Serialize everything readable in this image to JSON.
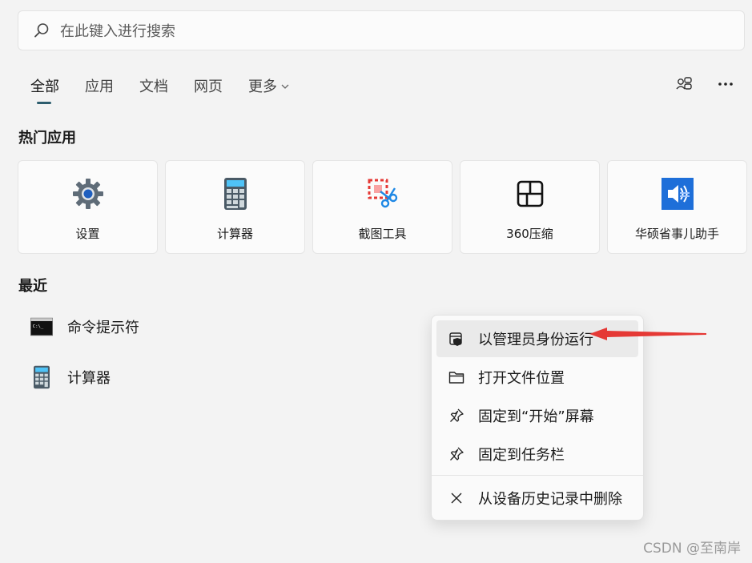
{
  "search": {
    "placeholder": "在此键入进行搜索"
  },
  "tabs": [
    {
      "label": "全部",
      "active": true
    },
    {
      "label": "应用"
    },
    {
      "label": "文档"
    },
    {
      "label": "网页"
    },
    {
      "label": "更多"
    }
  ],
  "sections": {
    "top_apps": "热门应用",
    "recent": "最近"
  },
  "top_apps": [
    {
      "label": "设置",
      "icon": "gear-icon"
    },
    {
      "label": "计算器",
      "icon": "calculator-icon"
    },
    {
      "label": "截图工具",
      "icon": "snipping-tool-icon"
    },
    {
      "label": "360压缩",
      "icon": "360-zip-icon"
    },
    {
      "label": "华硕省事儿助手",
      "icon": "asus-assistant-icon"
    }
  ],
  "recent": [
    {
      "label": "命令提示符",
      "icon": "terminal-icon"
    },
    {
      "label": "计算器",
      "icon": "calculator-icon"
    }
  ],
  "context_menu": [
    {
      "label": "以管理员身份运行",
      "icon": "shield-admin-icon",
      "highlighted": true
    },
    {
      "label": "打开文件位置",
      "icon": "folder-icon"
    },
    {
      "label": "固定到“开始”屏幕",
      "icon": "pin-icon"
    },
    {
      "label": "固定到任务栏",
      "icon": "pin-icon"
    },
    {
      "label": "从设备历史记录中删除",
      "icon": "close-icon"
    }
  ],
  "watermark": "CSDN @至南岸",
  "colors": {
    "accent": "#2d5d6e",
    "arrow": "#e53935",
    "background": "#f3f3f3"
  }
}
